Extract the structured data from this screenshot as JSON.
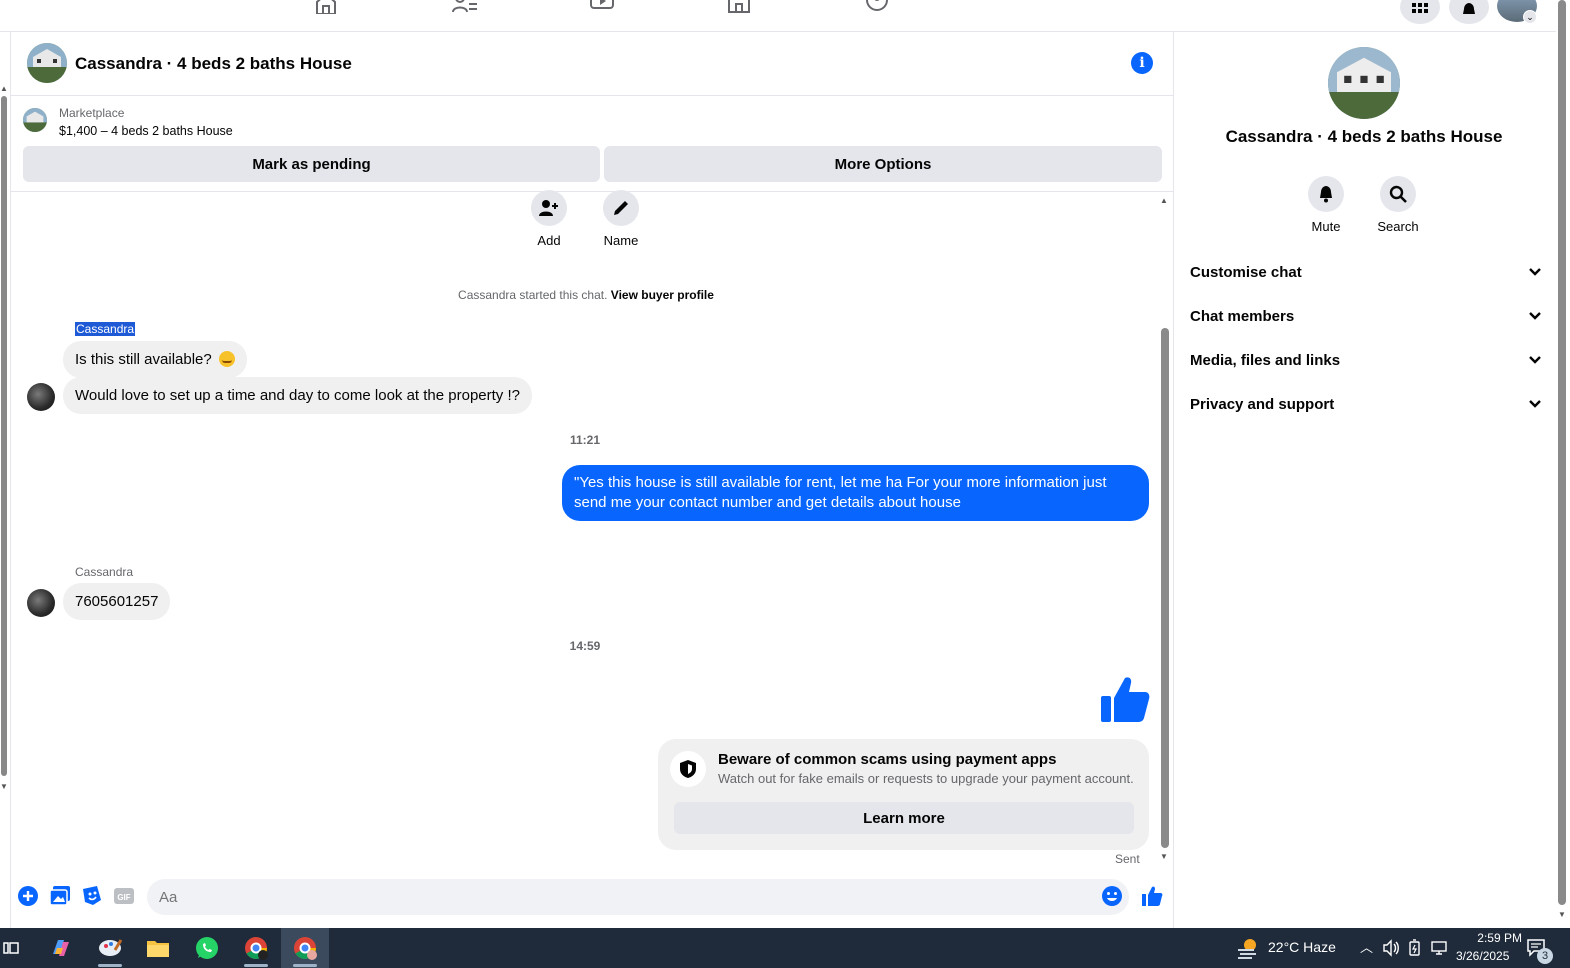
{
  "header": {
    "title": "Cassandra · 4 beds 2 baths House"
  },
  "marketplace": {
    "label": "Marketplace",
    "listing": "$1,400 – 4 beds 2 baths House",
    "mark_pending": "Mark as pending",
    "more_options": "More Options"
  },
  "actions": {
    "add": "Add",
    "name": "Name"
  },
  "system": {
    "started": "Cassandra started this chat.",
    "view_profile": "View buyer profile"
  },
  "messages": {
    "sender1": "Cassandra",
    "msg1": "Is this still available?",
    "msg2": "Would love to set up a time and day to come look at the property !?",
    "time1": "11:21",
    "out1": "\"Yes this house is still available for rent, let me ha For  your  more  information  just send  me   your  contact  number  and get details about house",
    "sender2": "Cassandra",
    "msg3": "7605601257",
    "time2": "14:59"
  },
  "scam": {
    "title": "Beware of common scams using payment apps",
    "subtitle": "Watch out for fake emails or requests to upgrade your payment account.",
    "learn_more": "Learn more"
  },
  "status": {
    "sent": "Sent"
  },
  "composer": {
    "placeholder": "Aa"
  },
  "sidebar": {
    "title": "Cassandra · 4 beds 2 baths House",
    "mute": "Mute",
    "search": "Search",
    "sections": [
      "Customise chat",
      "Chat members",
      "Media, files and links",
      "Privacy and support"
    ]
  },
  "taskbar": {
    "weather": "22°C  Haze",
    "time": "2:59 PM",
    "date": "3/26/2025",
    "notif_count": "3"
  },
  "colors": {
    "accent": "#0866ff",
    "bubble_in": "#f0f0f0",
    "button_bg": "#e4e6eb",
    "taskbar": "#1f2b3a"
  }
}
